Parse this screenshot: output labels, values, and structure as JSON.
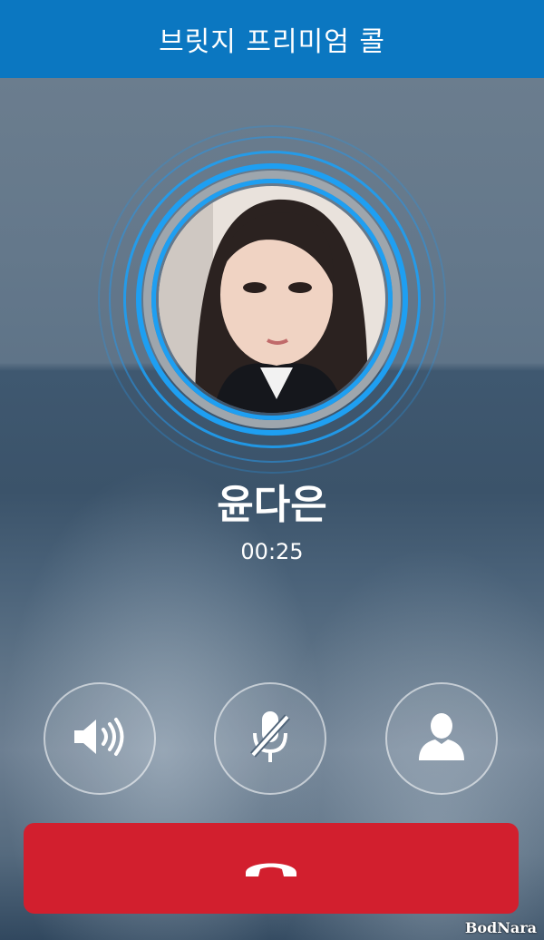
{
  "app": {
    "title": "브릿지 프리미엄 콜"
  },
  "call": {
    "caller_name": "윤다은",
    "duration": "00:25",
    "state": "connected"
  },
  "controls": [
    {
      "name": "speaker",
      "icon": "speaker-icon"
    },
    {
      "name": "mute",
      "icon": "mic-off-icon"
    },
    {
      "name": "contact",
      "icon": "person-icon"
    }
  ],
  "end_call": {
    "icon": "phone-hangup-icon"
  },
  "watermark": "BodNara",
  "colors": {
    "header": "#0b77c1",
    "ring_accent": "#1e9ff2",
    "end_button": "#d21f2e"
  }
}
